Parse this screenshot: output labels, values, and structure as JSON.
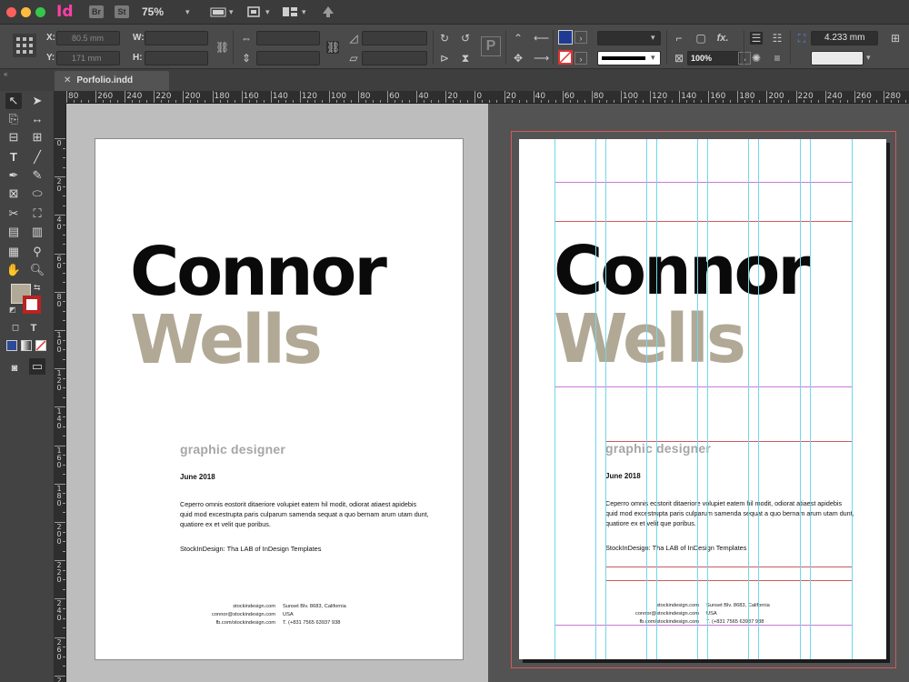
{
  "app": {
    "logo": "Id",
    "bridge_badge": "Br",
    "stock_badge": "St",
    "zoom": "75%",
    "traffic_colors": [
      "#fc605c",
      "#fdbc40",
      "#34c84a"
    ],
    "accent": "#ff3ea5"
  },
  "control_panel": {
    "x_label": "X:",
    "y_label": "Y:",
    "w_label": "W:",
    "h_label": "H:",
    "x_value": "80.5 mm",
    "y_value": "171 mm",
    "stroke_weight": "4.233 mm",
    "opacity": "100%",
    "fill_color": "#1f3a93"
  },
  "document": {
    "tab_title": "Porfolio.indd"
  },
  "rulers": {
    "horizontal": [
      "80",
      "260",
      "240",
      "220",
      "200",
      "180",
      "160",
      "140",
      "120",
      "100",
      "80",
      "60",
      "40",
      "20",
      "0",
      "20",
      "40",
      "60",
      "80",
      "100",
      "120",
      "140",
      "160",
      "180",
      "200",
      "220",
      "240",
      "260",
      "280"
    ],
    "vertical": [
      "0",
      "20",
      "40",
      "60",
      "80",
      "100",
      "120",
      "140",
      "160",
      "180",
      "200",
      "220",
      "240",
      "260",
      "280"
    ]
  },
  "page": {
    "first_name": "Connor",
    "last_name": "Wells",
    "role": "graphic designer",
    "date": "June 2018",
    "body": "Ceperro omnis eostorit ditaeriore volupiet eatem hil modit, odiorat atiaest apidebis quid mod excestrupta paris culparum samenda sequat a quo bernam arum utam dunt, quatiore ex et velit que poribus.",
    "tagline": "StockInDesign: Tha LAB of InDesign Templates",
    "contact_left": [
      "stockindesign.com",
      "connor@stockindesign.com",
      "fb.com/stockindesign.com"
    ],
    "contact_right": [
      "Sunset Blv. 8683, California",
      "USA",
      "T. (+831 7565 63937 938"
    ],
    "name_color": "#0a0a0a",
    "surname_color": "#b1a995"
  }
}
